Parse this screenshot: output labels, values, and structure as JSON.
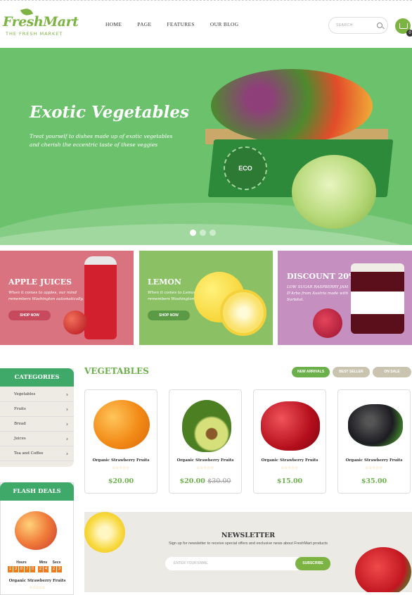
{
  "brand": {
    "name": "FreshMart",
    "tagline": "THE FRESH MARKET"
  },
  "nav": [
    "HOME",
    "PAGE",
    "FEATURES",
    "OUR BLOG"
  ],
  "search": {
    "placeholder": "SEARCH"
  },
  "cart": {
    "count": "0"
  },
  "hero": {
    "title": "Exotic Vegetables",
    "text": "Treat yourself to dishes made up of exotic vegetables and cherish the eccentric taste of these veggies",
    "seal": "ECO",
    "slides": 3,
    "active_slide": 1
  },
  "promos": [
    {
      "title": "APPLE JUICES",
      "text": "When it comes to apples, our mind remembers Washington automatically.",
      "button": "SHOP NOW",
      "color": "#d9737f"
    },
    {
      "title": "LEMON",
      "text": "When it comes to Lemon, our mind remembers Washington automatically.",
      "button": "SHOP NOW",
      "color": "#8cc065"
    },
    {
      "title": "DISCOUNT 20%",
      "text": "LOW SUGAR RASPBERRY JAM D'Arbo from Austria made with Sorbitol.",
      "button": "",
      "color": "#c58fc0"
    }
  ],
  "categories": {
    "title": "CATEGORIES",
    "items": [
      "Vegetables",
      "Fruits",
      "Bread",
      "Juices",
      "Tea and Coffee"
    ]
  },
  "flash": {
    "title": "FLASH DEALS",
    "hours_label": "Hours",
    "mins_label": "Mins",
    "secs_label": "Secs",
    "hours": [
      "1",
      "3",
      "8",
      "7",
      "0"
    ],
    "mins": [
      "2",
      "4"
    ],
    "secs": [
      "2",
      "3"
    ],
    "product": "Organic Strawberry Fruits"
  },
  "section": {
    "title": "VEGETABLES",
    "tabs": [
      "NEW ARRIVALS",
      "BEST SELLER",
      "ON SALE"
    ]
  },
  "products": [
    {
      "name": "Organic Strawberry Fruits",
      "price": "$20.00",
      "old": ""
    },
    {
      "name": "Organic Strawberry Fruits",
      "price": "$20.00",
      "old": "$30.00"
    },
    {
      "name": "Organic Strawberry Fruits",
      "price": "$15.00",
      "old": ""
    },
    {
      "name": "Organic Strawberry Fruits",
      "price": "$35.00",
      "old": ""
    }
  ],
  "newsletter": {
    "title": "NEWSLETTER",
    "text": "Sign up for newsletter to receive special offers and exclusive news about FreshMart products",
    "placeholder": "ENTER YOUR EMAIL",
    "button": "SUBSCRIBE"
  },
  "stars": "☆☆☆☆☆"
}
